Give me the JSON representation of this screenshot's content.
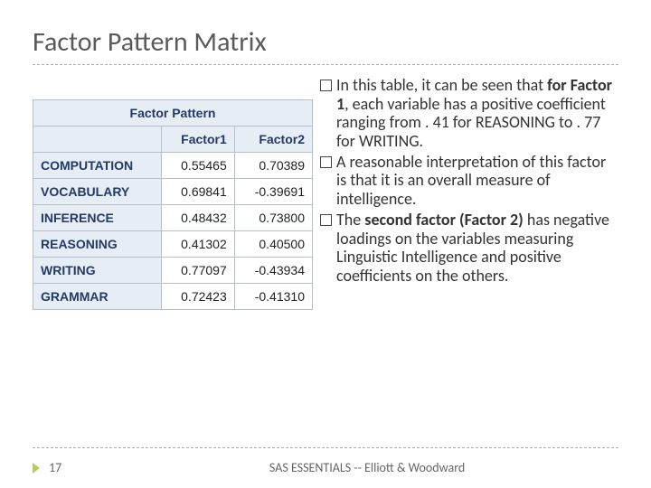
{
  "title": "Factor Pattern Matrix",
  "table": {
    "title": "Factor Pattern",
    "headers": [
      "Factor1",
      "Factor2"
    ],
    "rows": [
      {
        "label": "COMPUTATION",
        "f1": "0.55465",
        "f2": "0.70389"
      },
      {
        "label": "VOCABULARY",
        "f1": "0.69841",
        "f2": "-0.39691"
      },
      {
        "label": "INFERENCE",
        "f1": "0.48432",
        "f2": "0.73800"
      },
      {
        "label": "REASONING",
        "f1": "0.41302",
        "f2": "0.40500"
      },
      {
        "label": "WRITING",
        "f1": "0.77097",
        "f2": "-0.43934"
      },
      {
        "label": "GRAMMAR",
        "f1": "0.72423",
        "f2": "-0.41310"
      }
    ]
  },
  "bullets": {
    "b1a": "In this table, it can be seen that ",
    "b1b": "for Factor 1",
    "b1c": ", each variable has a positive coefficient ranging from . 41 for REASONING to . 77 for WRITING.",
    "b2": "A reasonable interpretation of this factor is that it is an overall measure of intelligence.",
    "b3a": "The ",
    "b3b": "second factor (Factor 2)",
    "b3c": " has negative loadings on the variables measuring Linguistic Intelligence and positive coefficients on the others."
  },
  "footer": {
    "page": "17",
    "source": "SAS ESSENTIALS -- Elliott & Woodward"
  }
}
